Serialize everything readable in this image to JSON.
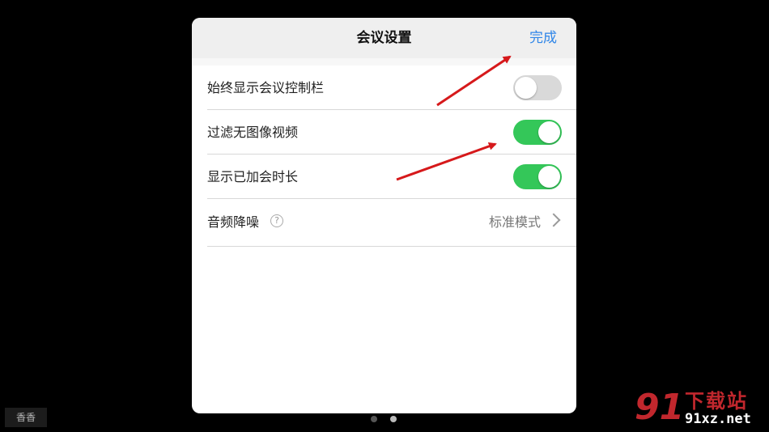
{
  "dialog": {
    "title": "会议设置",
    "done_label": "完成"
  },
  "settings": [
    {
      "label": "始终显示会议控制栏",
      "toggle": "off"
    },
    {
      "label": "过滤无图像视频",
      "toggle": "on"
    },
    {
      "label": "显示已加会时长",
      "toggle": "on"
    }
  ],
  "noise": {
    "label": "音频降噪",
    "help_glyph": "?",
    "value": "标准模式"
  },
  "user_tag": "香香",
  "page_indicator": {
    "count": 2,
    "active_index": 1
  },
  "watermark": {
    "logo": "91",
    "text": "下载站",
    "url": "91xz.net"
  },
  "colors": {
    "accent": "#2f86e8",
    "toggle_on": "#34c759",
    "toggle_off": "#d9d9d9",
    "annotation_arrow": "#d6191b"
  }
}
